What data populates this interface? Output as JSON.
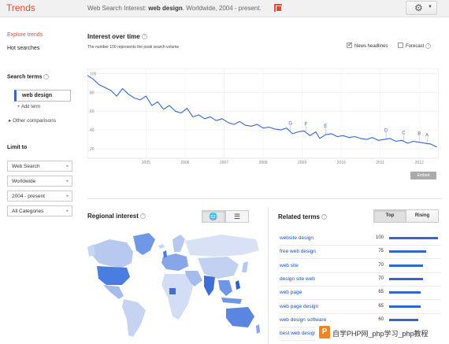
{
  "header": {
    "brand": "Trends",
    "title_prefix": "Web Search Interest: ",
    "title_term": "web design",
    "title_suffix": ". Worldwide, 2004 - present.",
    "share_icon": "share-icon",
    "settings_icon": "gear-icon"
  },
  "sidebar": {
    "explore": "Explore trends",
    "hot": "Hot searches",
    "search_terms_heading": "Search terms",
    "term": "web design",
    "add_term": "+ Add term",
    "other_comparisons": "Other comparisons",
    "limit_heading": "Limit to",
    "filters": [
      "Web Search",
      "Worldwide",
      "2004 - present",
      "All Categories"
    ]
  },
  "interest": {
    "title": "Interest over time",
    "note": "The number 100 represents the peak search volume",
    "news_label": "News headlines",
    "news_checked": true,
    "forecast_label": "Forecast",
    "forecast_checked": false,
    "embed_label": "Embed"
  },
  "chart_data": {
    "type": "line",
    "x_ticks": [
      "2005",
      "2006",
      "2007",
      "2008",
      "2009",
      "2010",
      "2011",
      "2012"
    ],
    "y_ticks": [
      20,
      40,
      60,
      80,
      100
    ],
    "ylim": [
      10,
      102
    ],
    "xlim": [
      2004.0,
      2013.0
    ],
    "series": [
      {
        "x": [
          2004.0,
          2004.15,
          2004.3,
          2004.45,
          2004.6,
          2004.75,
          2004.9,
          2005.05,
          2005.2,
          2005.35,
          2005.5,
          2005.65,
          2005.8,
          2005.95,
          2006.1,
          2006.25,
          2006.4,
          2006.55,
          2006.7,
          2006.85,
          2007.0,
          2007.15,
          2007.3,
          2007.45,
          2007.6,
          2007.75,
          2007.9,
          2008.05,
          2008.2,
          2008.35,
          2008.5,
          2008.65,
          2008.8,
          2008.95,
          2009.1,
          2009.25,
          2009.4,
          2009.55,
          2009.7,
          2009.85,
          2009.95,
          2010.1,
          2010.25,
          2010.4,
          2010.55,
          2010.7,
          2010.85,
          2011.0,
          2011.15,
          2011.3,
          2011.45,
          2011.6,
          2011.75,
          2011.9,
          2012.05,
          2012.2,
          2012.35,
          2012.5,
          2012.65,
          2012.8,
          2012.95
        ],
        "y": [
          98,
          94,
          88,
          85,
          82,
          76,
          84,
          78,
          74,
          72,
          76,
          66,
          70,
          62,
          66,
          60,
          58,
          63,
          54,
          56,
          52,
          54,
          50,
          52,
          48,
          46,
          49,
          45,
          44,
          46,
          42,
          43,
          41,
          40,
          42,
          36,
          38,
          39,
          34,
          38,
          31,
          35,
          36,
          33,
          34,
          32,
          33,
          31,
          30,
          32,
          29,
          30,
          31,
          28,
          29,
          26,
          28,
          27,
          26,
          25,
          22
        ]
      }
    ],
    "markers": [
      {
        "label": "G",
        "x": 2009.2
      },
      {
        "label": "F",
        "x": 2009.6
      },
      {
        "label": "E",
        "x": 2010.1
      },
      {
        "label": "D",
        "x": 2011.65
      },
      {
        "label": "C",
        "x": 2012.1
      },
      {
        "label": "B",
        "x": 2012.5
      },
      {
        "label": "A",
        "x": 2012.7
      }
    ],
    "grid": true,
    "line_color": "#3366cc"
  },
  "regional": {
    "title": "Regional interest",
    "map_icon": "globe-icon",
    "list_icon": "list-icon"
  },
  "related": {
    "title": "Related terms",
    "tabs": [
      "Top",
      "Rising"
    ],
    "rows": [
      {
        "name": "website design",
        "value": 100
      },
      {
        "name": "free web design",
        "value": 75
      },
      {
        "name": "web site",
        "value": 70
      },
      {
        "name": "design site web",
        "value": 70
      },
      {
        "name": "web page",
        "value": 65
      },
      {
        "name": "web page design",
        "value": 65
      },
      {
        "name": "web design software",
        "value": 60
      },
      {
        "name": "best web design",
        "value": 55
      }
    ]
  },
  "watermark": {
    "logo": "P",
    "text": "自学PHP网_php学习_php教程"
  }
}
